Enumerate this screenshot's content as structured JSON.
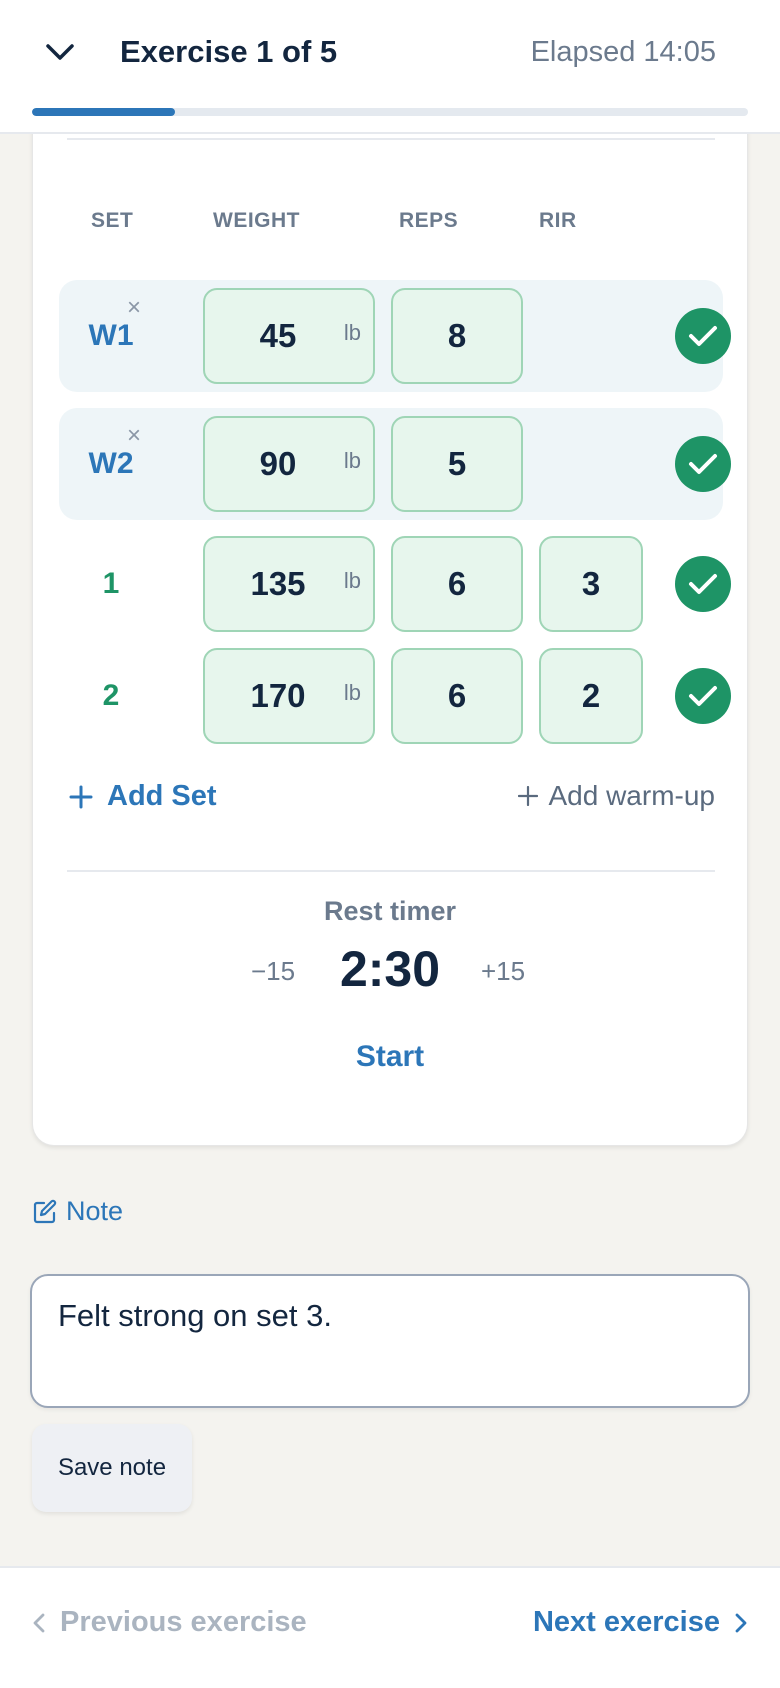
{
  "header": {
    "title": "Exercise 1 of 5",
    "elapsed": "Elapsed 14:05",
    "progress_fraction": 0.2
  },
  "table": {
    "headers": {
      "set": "SET",
      "weight": "WEIGHT",
      "reps": "REPS",
      "rir": "RIR"
    },
    "unit": "lb",
    "remove_symbol": "×",
    "sets": [
      {
        "label": "W1",
        "weight": "45",
        "reps": "8",
        "rir": "",
        "completed": true
      },
      {
        "label": "W2",
        "weight": "90",
        "reps": "5",
        "rir": "",
        "completed": true
      },
      {
        "label": "1",
        "weight": "135",
        "reps": "6",
        "rir": "3",
        "completed": true
      },
      {
        "label": "2",
        "weight": "170",
        "reps": "6",
        "rir": "2",
        "completed": true
      }
    ]
  },
  "actions": {
    "add_set": "Add Set",
    "add_warmup": "Add warm-up"
  },
  "rest_timer": {
    "label": "Rest timer",
    "minus": "−15",
    "time": "2:30",
    "plus": "+15",
    "start": "Start"
  },
  "note": {
    "link_label": "Note",
    "value": "Felt strong on set 3.",
    "save_label": "Save note"
  },
  "footer": {
    "previous": "Previous exercise",
    "next": "Next exercise"
  },
  "colors": {
    "accent_blue": "#2c76b8",
    "success_green": "#1e9466",
    "cell_fill": "#e7f6ed"
  }
}
